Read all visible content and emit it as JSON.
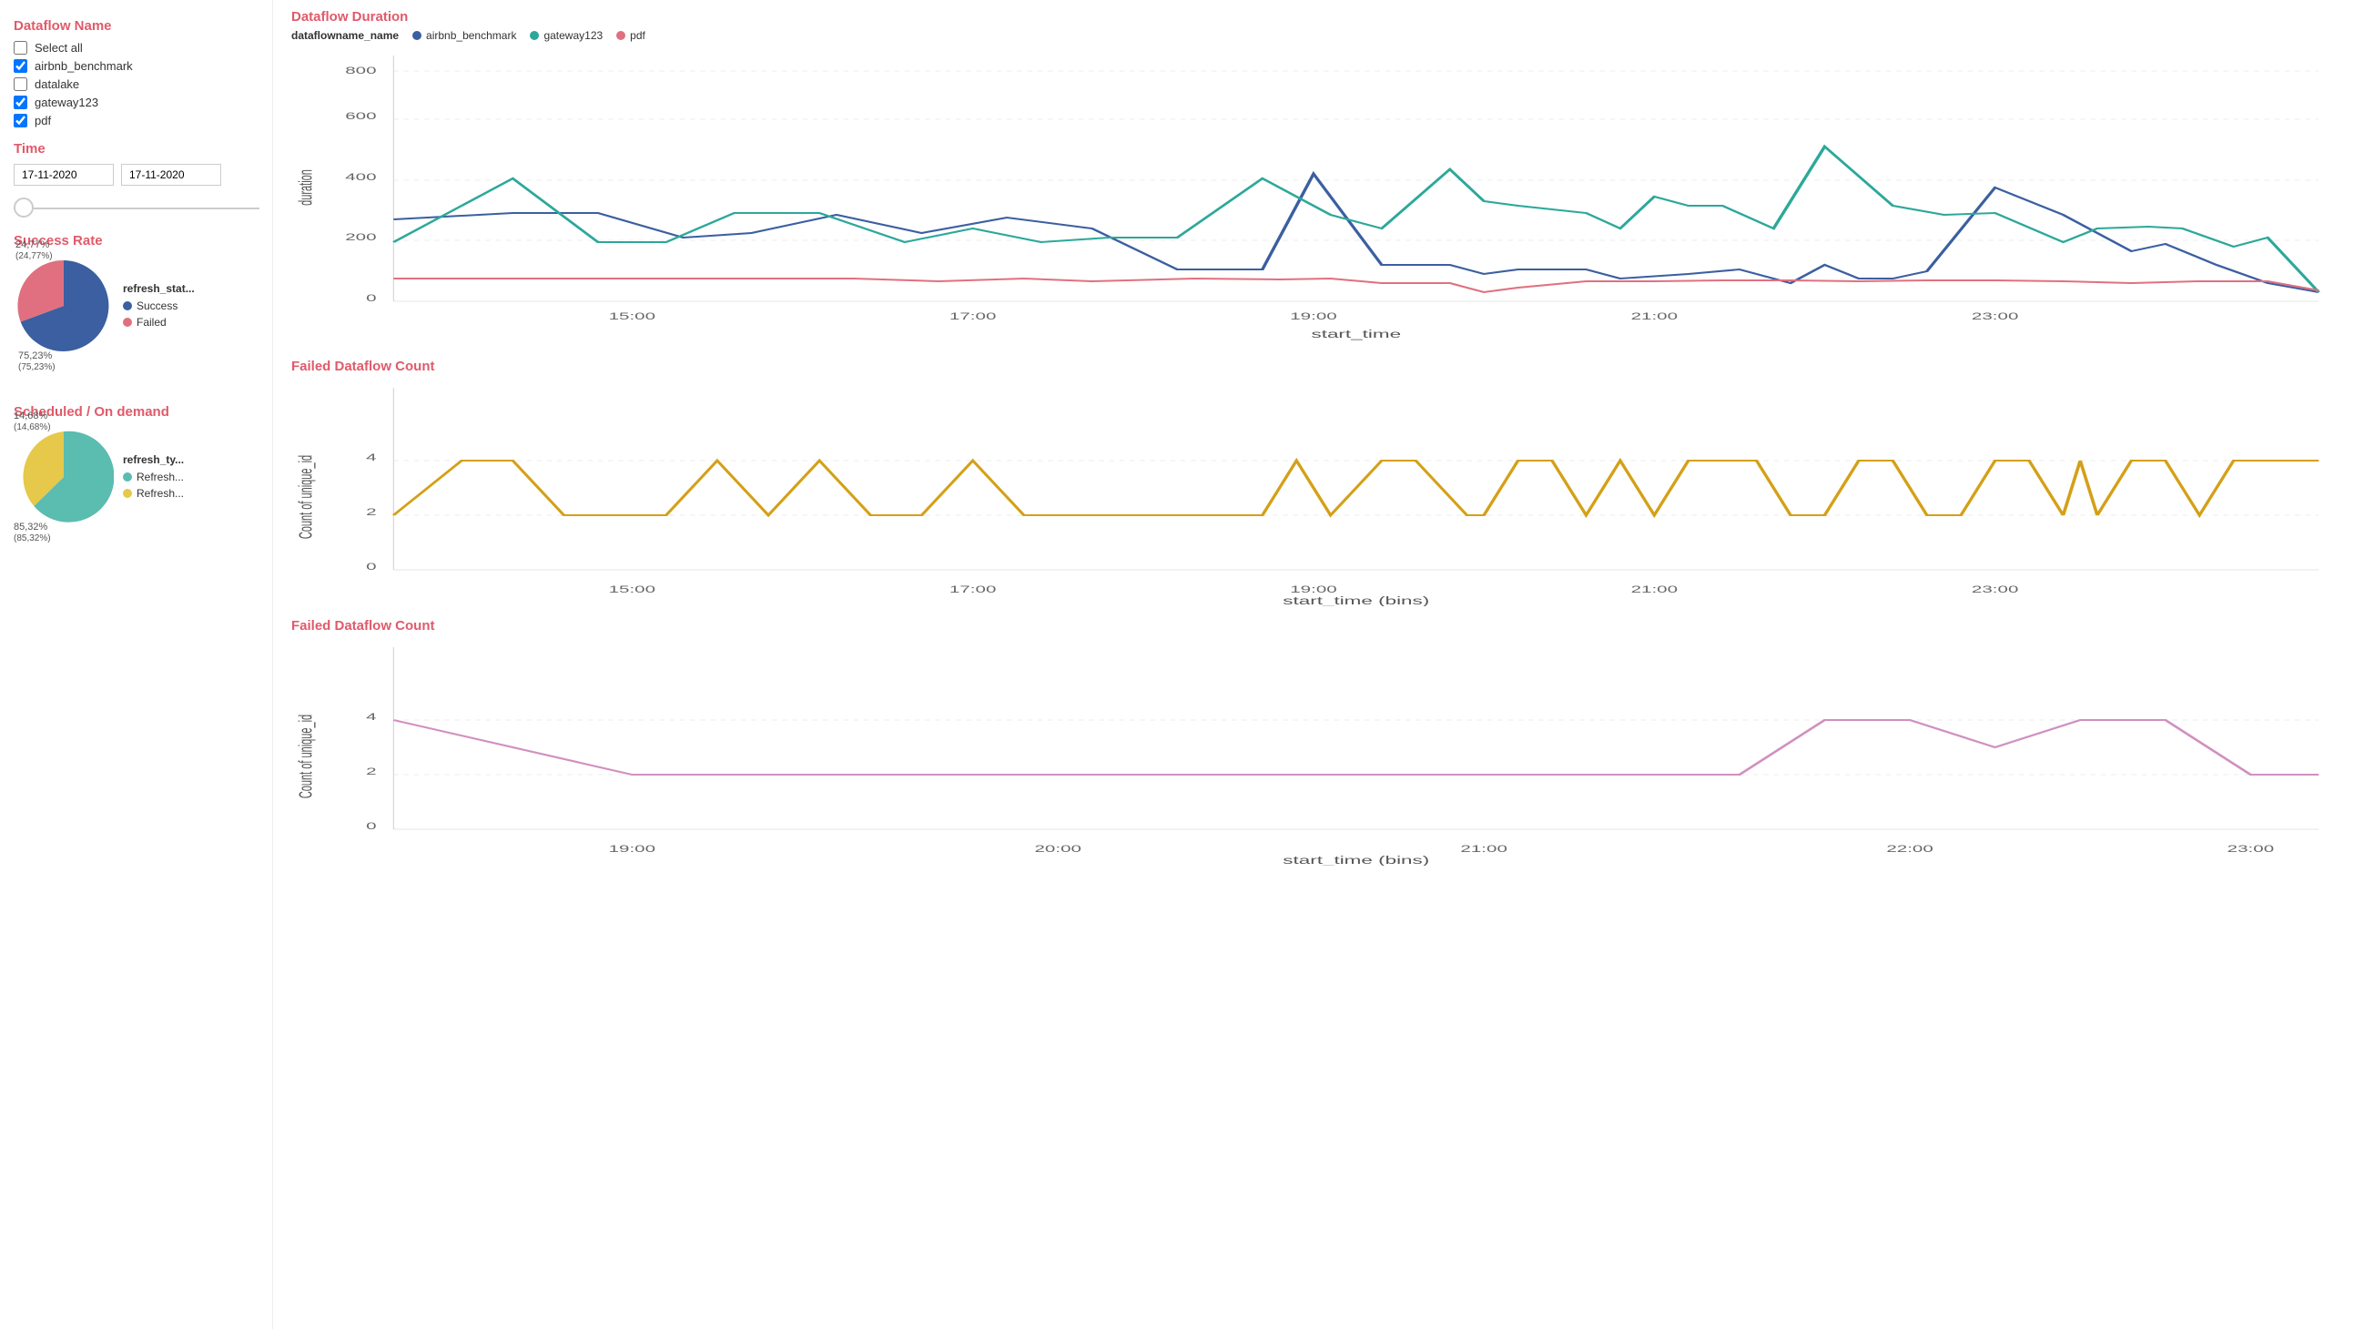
{
  "sidebar": {
    "dataflow_name_title": "Dataflow Name",
    "select_all_label": "Select all",
    "checkboxes": [
      {
        "id": "airbnb",
        "label": "airbnb_benchmark",
        "checked": true
      },
      {
        "id": "datalake",
        "label": "datalake",
        "checked": false
      },
      {
        "id": "gateway",
        "label": "gateway123",
        "checked": true
      },
      {
        "id": "pdf",
        "label": "pdf",
        "checked": true
      }
    ],
    "time_title": "Time",
    "date_from": "17-11-2020",
    "date_to": "17-11-2020",
    "success_rate_title": "Success Rate",
    "pie1": {
      "legend_title": "refresh_stat...",
      "segments": [
        {
          "label": "Success",
          "color": "#3b5fa0",
          "value": 75.23,
          "display": "75,23%\n(75,23%)"
        },
        {
          "label": "Failed",
          "color": "#e07080",
          "value": 24.77,
          "display": "24,77%\n(24,77%)"
        }
      ]
    },
    "scheduled_title": "Scheduled / On demand",
    "pie2": {
      "legend_title": "refresh_ty...",
      "segments": [
        {
          "label": "Refresh...",
          "color": "#5bbcb0",
          "value": 85.32,
          "display": "85,32%\n(85,32%)"
        },
        {
          "label": "Refresh...",
          "color": "#e6c84a",
          "value": 14.68,
          "display": "14,68%\n(14,68%)"
        }
      ]
    }
  },
  "charts": {
    "duration_title": "Dataflow Duration",
    "legend_name_label": "dataflowname_name",
    "legend_items": [
      {
        "label": "airbnb_benchmark",
        "color": "#3b5fa0"
      },
      {
        "label": "gateway123",
        "color": "#2ca89a"
      },
      {
        "label": "pdf",
        "color": "#e07080"
      }
    ],
    "duration_y_label": "duration",
    "duration_x_label": "start_time",
    "failed_count_title": "Failed Dataflow Count",
    "failed_y_label": "Count of unique_id",
    "failed_x_label": "start_time (bins)",
    "failed2_title": "Failed Dataflow Count",
    "failed2_x_label": "start_time (bins)"
  }
}
